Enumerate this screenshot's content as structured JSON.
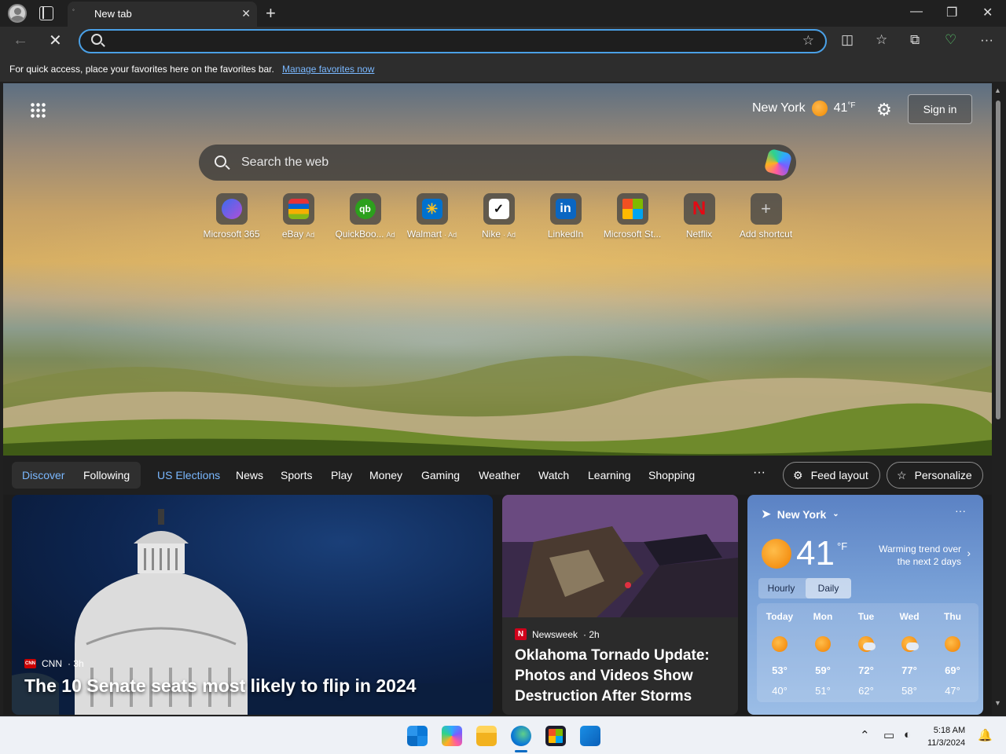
{
  "browser": {
    "tab_title": "New tab",
    "address_value": "",
    "favorites_bar_text": "For quick access, place your favorites here on the favorites bar.",
    "favorites_bar_link": "Manage favorites now"
  },
  "header": {
    "location": "New York",
    "temperature": "41",
    "temp_unit": "°F",
    "sign_in_label": "Sign in"
  },
  "search": {
    "placeholder": "Search the web"
  },
  "shortcuts": [
    {
      "label": "Microsoft 365",
      "ad": "",
      "icon": "microsoft-365-icon"
    },
    {
      "label": "eBay",
      "ad": "Ad",
      "icon": "ebay-icon"
    },
    {
      "label": "QuickBoo...",
      "ad": "Ad",
      "icon": "quickbooks-icon"
    },
    {
      "label": "Walmart",
      "ad": "· Ad",
      "icon": "walmart-icon"
    },
    {
      "label": "Nike",
      "ad": "· Ad",
      "icon": "nike-icon"
    },
    {
      "label": "LinkedIn",
      "ad": "",
      "icon": "linkedin-icon"
    },
    {
      "label": "Microsoft St...",
      "ad": "",
      "icon": "microsoft-store-icon"
    },
    {
      "label": "Netflix",
      "ad": "",
      "icon": "netflix-icon"
    },
    {
      "label": "Add shortcut",
      "ad": "",
      "icon": "plus-icon"
    }
  ],
  "feed_nav": {
    "discover": "Discover",
    "following": "Following",
    "items": [
      "US Elections",
      "News",
      "Sports",
      "Play",
      "Money",
      "Gaming",
      "Weather",
      "Watch",
      "Learning",
      "Shopping"
    ],
    "more": "···",
    "feed_layout": "Feed layout",
    "personalize": "Personalize"
  },
  "cards": {
    "main": {
      "source": "CNN",
      "age": "· 3h",
      "title": "The 10 Senate seats most likely to flip in 2024"
    },
    "secondary": {
      "source": "Newsweek",
      "age": "· 2h",
      "title": "Oklahoma Tornado Update: Photos and Videos Show Destruction After Storms"
    }
  },
  "weather_card": {
    "location": "New York",
    "temperature": "41",
    "unit": "°F",
    "trend": "Warming trend over the next 2 days",
    "tab_hourly": "Hourly",
    "tab_daily": "Daily",
    "days": [
      {
        "name": "Today",
        "hi": "53°",
        "lo": "40°",
        "icon": "sunny-icon"
      },
      {
        "name": "Mon",
        "hi": "59°",
        "lo": "51°",
        "icon": "sunny-icon"
      },
      {
        "name": "Tue",
        "hi": "72°",
        "lo": "62°",
        "icon": "partly-cloudy-icon"
      },
      {
        "name": "Wed",
        "hi": "77°",
        "lo": "58°",
        "icon": "partly-cloudy-icon"
      },
      {
        "name": "Thu",
        "hi": "69°",
        "lo": "47°",
        "icon": "sunny-icon"
      }
    ]
  },
  "taskbar": {
    "time": "5:18 AM",
    "date": "11/3/2024"
  }
}
